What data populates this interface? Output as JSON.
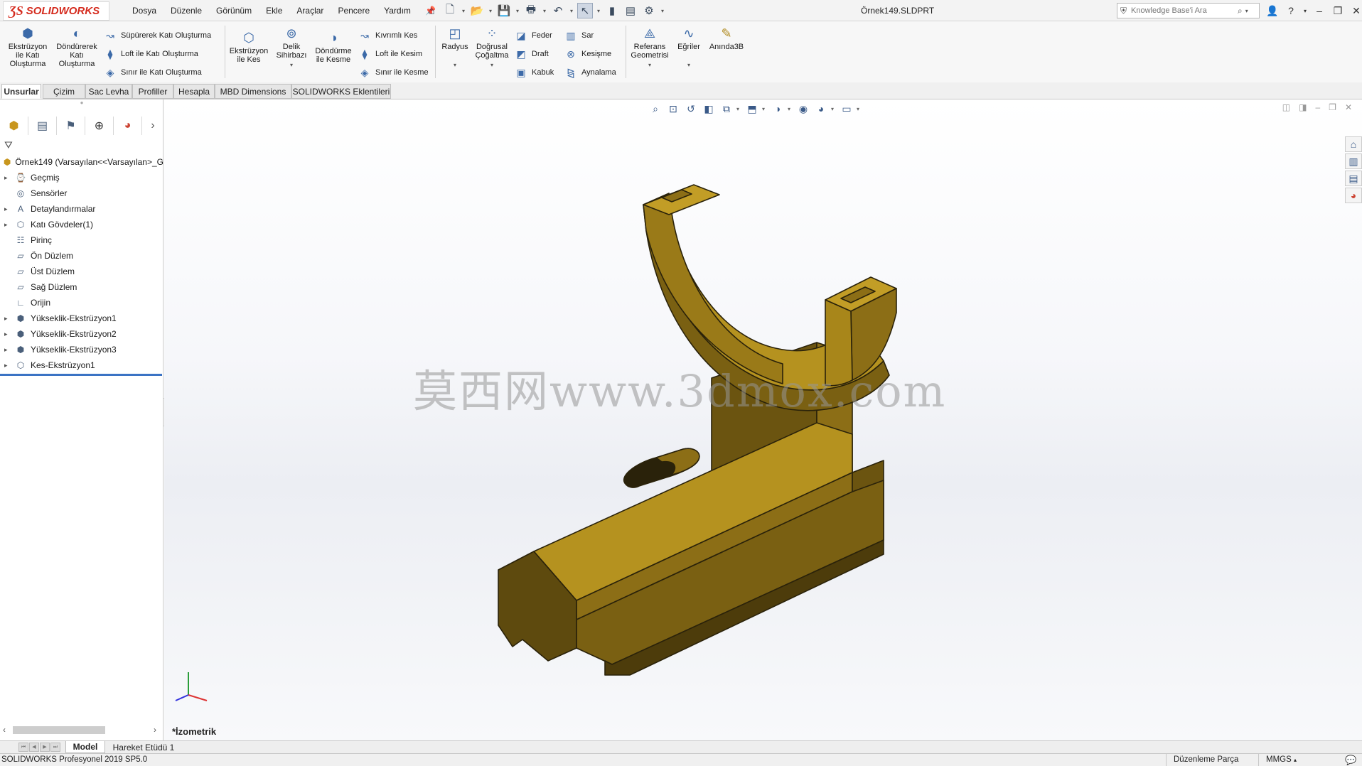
{
  "app": {
    "name": "SOLIDWORKS",
    "document_title": "Örnek149.SLDPRT"
  },
  "menu": [
    "Dosya",
    "Düzenle",
    "Görünüm",
    "Ekle",
    "Araçlar",
    "Pencere",
    "Yardım"
  ],
  "search": {
    "placeholder": "Knowledge Base'i Ara"
  },
  "commands": {
    "extrude_boss": "Ekstrüzyon ile Katı Oluşturma",
    "revolve_boss": "Döndürerek Katı Oluşturma",
    "sweep_boss": "Süpürerek Katı Oluşturma",
    "loft_boss": "Loft ile Katı Oluşturma",
    "boundary_boss": "Sınır ile Katı Oluşturma",
    "extrude_cut": "Ekstrüzyon ile Kes",
    "hole_wizard": "Delik Sihirbazı",
    "revolve_cut": "Döndürme ile Kesme",
    "swept_cut": "Kıvrımlı Kes",
    "loft_cut": "Loft ile Kesim",
    "boundary_cut": "Sınır ile Kesme",
    "fillet": "Radyus",
    "linear_pattern": "Doğrusal Çoğaltma",
    "rib": "Feder",
    "draft": "Draft",
    "shell": "Kabuk",
    "wrap": "Sar",
    "intersect": "Kesişme",
    "mirror": "Aynalama",
    "ref_geometry": "Referans Geometrisi",
    "curves": "Eğriler",
    "instant3d": "Anında3B"
  },
  "tabs": [
    "Unsurlar",
    "Çizim",
    "Sac Levha",
    "Profiller",
    "Hesapla",
    "MBD Dimensions",
    "SOLIDWORKS Eklentileri"
  ],
  "feature_tree": {
    "root": "Örnek149  (Varsayılan<<Varsayılan>_G",
    "items": [
      {
        "label": "Geçmiş",
        "expandable": true,
        "icon": "history-icon"
      },
      {
        "label": "Sensörler",
        "expandable": false,
        "icon": "sensor-icon"
      },
      {
        "label": "Detaylandırmalar",
        "expandable": true,
        "icon": "annotation-icon"
      },
      {
        "label": "Katı Gövdeler(1)",
        "expandable": true,
        "icon": "solid-body-icon"
      },
      {
        "label": "Pirinç",
        "expandable": false,
        "icon": "material-icon"
      },
      {
        "label": "Ön Düzlem",
        "expandable": false,
        "icon": "plane-icon"
      },
      {
        "label": "Üst Düzlem",
        "expandable": false,
        "icon": "plane-icon"
      },
      {
        "label": "Sağ Düzlem",
        "expandable": false,
        "icon": "plane-icon"
      },
      {
        "label": "Orijin",
        "expandable": false,
        "icon": "origin-icon"
      },
      {
        "label": "Yükseklik-Ekstrüzyon1",
        "expandable": true,
        "icon": "extrude-icon"
      },
      {
        "label": "Yükseklik-Ekstrüzyon2",
        "expandable": true,
        "icon": "extrude-icon"
      },
      {
        "label": "Yükseklik-Ekstrüzyon3",
        "expandable": true,
        "icon": "extrude-icon"
      },
      {
        "label": "Kes-Ekstrüzyon1",
        "expandable": true,
        "icon": "cut-extrude-icon"
      }
    ]
  },
  "viewport": {
    "view_name": "*İzometrik",
    "watermark": "莫西网www.3dmox.com",
    "part_color": "#a8861a"
  },
  "bottom_tabs": [
    "Model",
    "Hareket Etüdü 1"
  ],
  "status": {
    "version": "SOLIDWORKS Profesyonel 2019 SP5.0",
    "mode": "Düzenleme Parça",
    "units": "MMGS"
  }
}
